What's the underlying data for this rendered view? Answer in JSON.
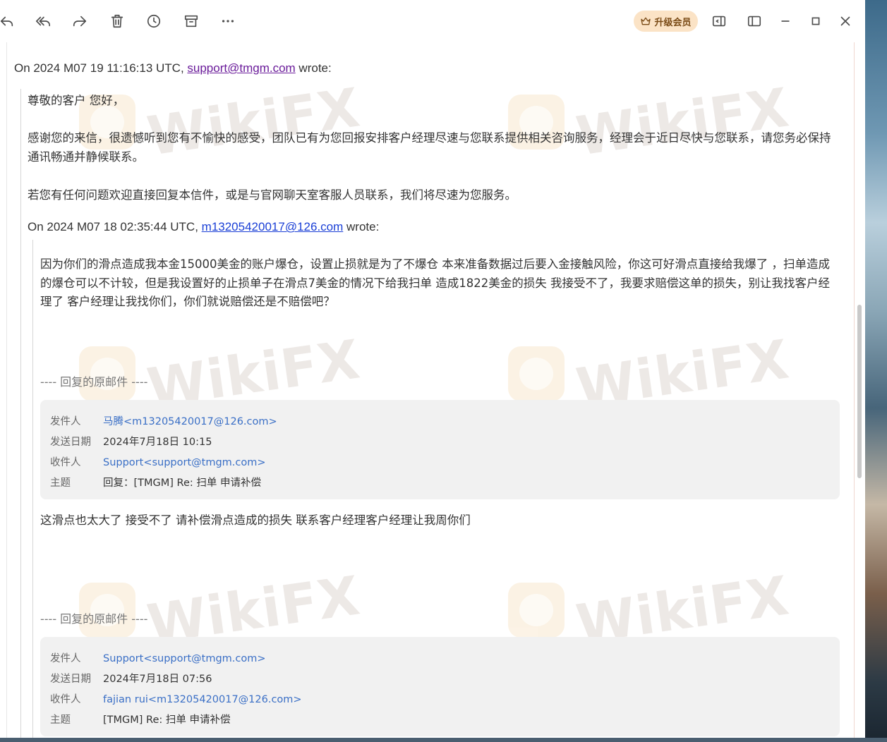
{
  "toolbar": {
    "upgrade_label": "升级会员",
    "icons": [
      "reply-icon",
      "reply-all-icon",
      "forward-icon",
      "trash-icon",
      "clock-icon",
      "archive-icon",
      "more-icon",
      "sidebar-left-icon",
      "sidebar-right-icon",
      "minimize-icon",
      "maximize-icon",
      "close-icon"
    ]
  },
  "watermark": "WikiFX",
  "email": {
    "wrote1_prefix": "On 2024 M07 19 11:16:13 UTC, ",
    "wrote1_email": "support@tmgm.com",
    "wrote1_suffix": " wrote:",
    "greeting": "尊敬的客户 您好，",
    "body1": "感谢您的来信，很遗憾听到您有不愉快的感受，团队已有为您回报安排客户经理尽速与您联系提供相关咨询服务，经理会于近日尽快与您联系，请您务必保持通讯畅通并静候联系。",
    "body2": "若您有任何问题欢迎直接回复本信件，或是与官网聊天室客服人员联系，我们将尽速为您服务。",
    "wrote2_prefix": "On 2024 M07 18 02:35:44 UTC, ",
    "wrote2_email": "m13205420017@126.com",
    "wrote2_suffix": " wrote:",
    "complaint": "因为你们的滑点造成我本金15000美金的账户爆仓，设置止损就是为了不爆仓 本来准备数据过后要入金接触风险，你这可好滑点直接给我爆了 ，扫单造成的爆仓可以不计较，但是我设置好的止损单子在滑点7美金的情况下给我扫单 造成1822美金的损失 我接受不了，我要求赔偿这单的损失，别让我找客户经理了 客户经理让我找你们，你们就说赔偿还是不赔偿吧？",
    "separator": "---- 回复的原邮件 ----",
    "header1": {
      "from_label": "发件人",
      "from": "马腾<m13205420017@126.com>",
      "date_label": "发送日期",
      "date": "2024年7月18日 10:15",
      "to_label": "收件人",
      "to": "Support<support@tmgm.com>",
      "subject_label": "主题",
      "subject": "回复：[TMGM] Re: 扫单 申请补偿"
    },
    "body3": "这滑点也太大了 接受不了 请补偿滑点造成的损失  联系客户经理客户经理让我周你们",
    "header2": {
      "from_label": "发件人",
      "from": "Support<support@tmgm.com>",
      "date_label": "发送日期",
      "date": "2024年7月18日 07:56",
      "to_label": "收件人",
      "to": "fajian rui<m13205420017@126.com>",
      "subject_label": "主题",
      "subject": "[TMGM] Re: 扫单 申请补偿"
    }
  },
  "colors": {
    "link_visited": "#6a1b9a",
    "link": "#1a3fd6",
    "hdr_link": "#3a6fc6",
    "upgrade_bg": "#fbe3c6"
  }
}
